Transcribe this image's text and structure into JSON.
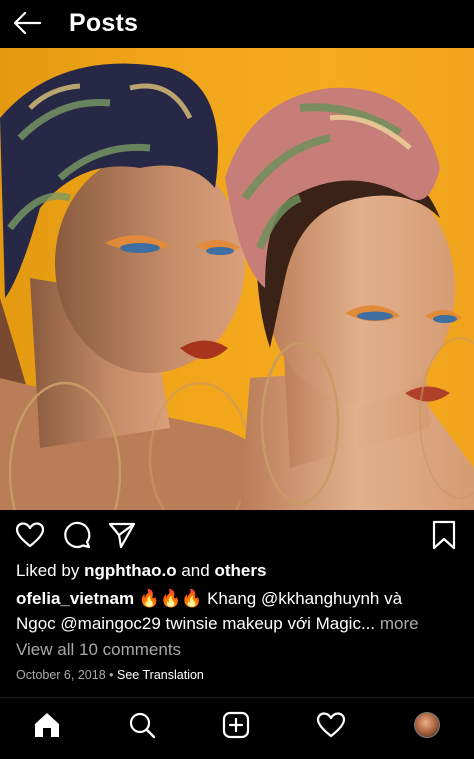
{
  "header": {
    "title": "Posts",
    "back_icon": "arrow-left-icon"
  },
  "post": {
    "image_description_colors": {
      "background": "#f2a51c"
    },
    "likes": {
      "prefix": "Liked by",
      "user": "ngphthao.o",
      "joiner": "and",
      "others": "others"
    },
    "caption": {
      "username": "ofelia_vietnam",
      "emoji": "🔥🔥🔥",
      "text_line1": "Khang @kkhanghuynh và",
      "text_line2": "Ngọc @maingoc29 twinsie makeup với Magic...",
      "more": "more"
    },
    "view_comments": "View all 10 comments",
    "date": "October 6, 2018",
    "separator": "•",
    "see_translation": "See Translation"
  },
  "actions": {
    "like": "heart-icon",
    "comment": "comment-icon",
    "share": "send-icon",
    "save": "bookmark-icon"
  },
  "bottom_nav": [
    "home-icon",
    "search-icon",
    "add-post-icon",
    "activity-heart-icon",
    "profile-avatar"
  ]
}
